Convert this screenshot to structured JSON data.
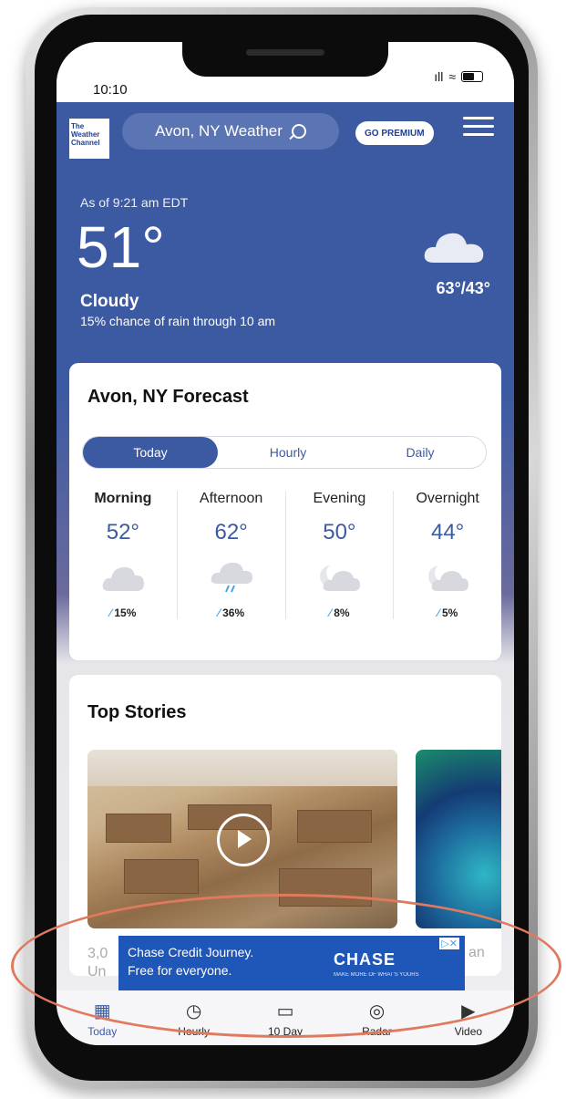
{
  "status_bar": {
    "time": "10:10",
    "signal": "ıll",
    "wifi": "≈"
  },
  "header": {
    "logo_lines": [
      "The",
      "Weather",
      "Channel"
    ],
    "search_label": "Avon, NY Weather",
    "premium_label": "GO PREMIUM"
  },
  "current": {
    "as_of": "As of 9:21 am EDT",
    "temp": "51°",
    "phrase": "Cloudy",
    "precip": "15% chance of rain through 10 am",
    "hi_lo": "63°/43°",
    "icon": "cloud-icon"
  },
  "forecast": {
    "title": "Avon, NY Forecast",
    "tabs": [
      {
        "label": "Today",
        "active": true
      },
      {
        "label": "Hourly",
        "active": false
      },
      {
        "label": "Daily",
        "active": false
      }
    ],
    "dayparts": [
      {
        "name": "Morning",
        "temp": "52°",
        "icon": "cloud-icon",
        "rain": "15%"
      },
      {
        "name": "Afternoon",
        "temp": "62°",
        "icon": "rain-cloud-icon",
        "rain": "36%"
      },
      {
        "name": "Evening",
        "temp": "50°",
        "icon": "partly-cloudy-night-icon",
        "rain": "8%"
      },
      {
        "name": "Overnight",
        "temp": "44°",
        "icon": "partly-cloudy-night-icon",
        "rain": "5%"
      }
    ]
  },
  "stories": {
    "title": "Top Stories",
    "caption_1_line1": "3,0",
    "caption_1_line2": "Un",
    "caption_2": "an"
  },
  "ad": {
    "line1": "Chase Credit Journey.",
    "line2": "Free for everyone.",
    "brand": "CHASE",
    "tagline": "MAKE MORE OF WHAT'S YOURS"
  },
  "bottom_nav": [
    {
      "label": "Today",
      "icon": "calendar-today-icon",
      "glyph": "▦",
      "active": true
    },
    {
      "label": "Hourly",
      "icon": "clock-icon",
      "glyph": "◷",
      "active": false
    },
    {
      "label": "10 Day",
      "icon": "calendar-icon",
      "glyph": "▭",
      "active": false
    },
    {
      "label": "Radar",
      "icon": "radar-icon",
      "glyph": "◎",
      "active": false
    },
    {
      "label": "Video",
      "icon": "play-icon",
      "glyph": "▶",
      "active": false
    }
  ]
}
